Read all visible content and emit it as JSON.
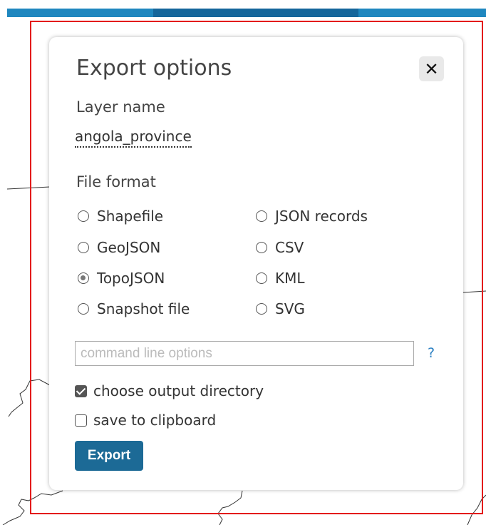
{
  "dialog": {
    "title": "Export options",
    "close_label": "✕",
    "layer_name_label": "Layer name",
    "layer_name_value": "angola_province",
    "file_format_label": "File format",
    "formats": [
      {
        "label": "Shapefile",
        "checked": false
      },
      {
        "label": "GeoJSON",
        "checked": false
      },
      {
        "label": "TopoJSON",
        "checked": true
      },
      {
        "label": "Snapshot file",
        "checked": false
      },
      {
        "label": "JSON records",
        "checked": false
      },
      {
        "label": "CSV",
        "checked": false
      },
      {
        "label": "KML",
        "checked": false
      },
      {
        "label": "SVG",
        "checked": false
      }
    ],
    "command_line": {
      "value": "",
      "placeholder": "command line options"
    },
    "help_label": "?",
    "choose_output_directory": {
      "label": "choose output directory",
      "checked": true
    },
    "save_to_clipboard": {
      "label": "save to clipboard",
      "checked": false
    },
    "export_label": "Export"
  },
  "colors": {
    "top_bar": "#1f87bf",
    "top_bar_active": "#15669b",
    "export_button": "#1c6a96",
    "highlight_border": "#e31b1b",
    "help_link": "#2a7fc2"
  }
}
